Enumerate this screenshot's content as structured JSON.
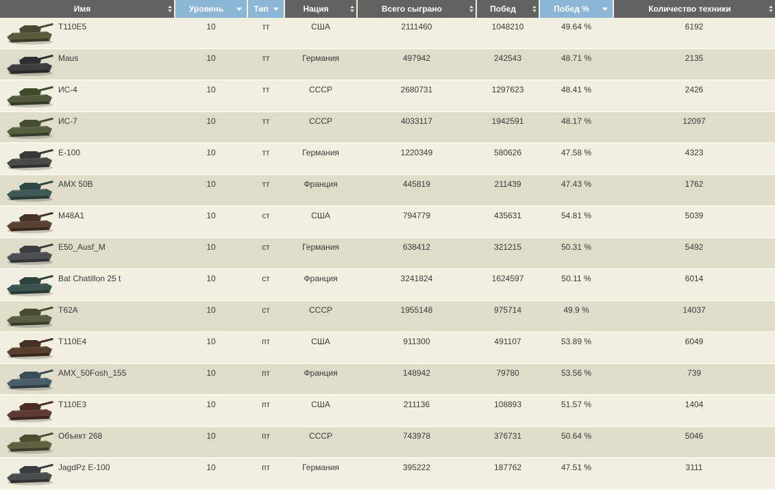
{
  "headers": [
    {
      "key": "name",
      "label": "Имя",
      "sorted": false,
      "icon": "sort-icon"
    },
    {
      "key": "level",
      "label": "Уровень",
      "sorted": true,
      "icon": "chevron-down-icon"
    },
    {
      "key": "type",
      "label": "Тип",
      "sorted": true,
      "icon": "chevron-down-icon"
    },
    {
      "key": "nation",
      "label": "Нация",
      "sorted": false,
      "icon": "sort-icon"
    },
    {
      "key": "played",
      "label": "Всего сыграно",
      "sorted": false,
      "icon": "sort-icon"
    },
    {
      "key": "wins",
      "label": "Побед",
      "sorted": false,
      "icon": "sort-icon"
    },
    {
      "key": "winrate",
      "label": "Побед %",
      "sorted": true,
      "icon": "chevron-down-icon"
    },
    {
      "key": "count",
      "label": "Количество техники",
      "sorted": false,
      "icon": "sort-icon"
    }
  ],
  "colors": {
    "header_bg": "#626262",
    "header_sorted_bg": "#8cb6d6",
    "row_odd": "#f1efe0",
    "row_even": "#dfdcca"
  },
  "rows": [
    {
      "name": "T110E5",
      "level": "10",
      "type": "тт",
      "nation": "США",
      "played": "2111460",
      "wins": "1048210",
      "winrate": "49.64 %",
      "count": "6192",
      "hull": "#5a5a3c",
      "turret": "#4a4a30"
    },
    {
      "name": "Maus",
      "level": "10",
      "type": "тт",
      "nation": "Германия",
      "played": "497942",
      "wins": "242543",
      "winrate": "48.71 %",
      "count": "2135",
      "hull": "#3e3e3e",
      "turret": "#2f2f2f"
    },
    {
      "name": "ИС-4",
      "level": "10",
      "type": "тт",
      "nation": "СССР",
      "played": "2680731",
      "wins": "1297623",
      "winrate": "48.41 %",
      "count": "2426",
      "hull": "#4f5a3a",
      "turret": "#3f4a2c"
    },
    {
      "name": "ИС-7",
      "level": "10",
      "type": "тт",
      "nation": "СССР",
      "played": "4033117",
      "wins": "1942591",
      "winrate": "48.17 %",
      "count": "12097",
      "hull": "#56603f",
      "turret": "#444e30"
    },
    {
      "name": "E-100",
      "level": "10",
      "type": "тт",
      "nation": "Германия",
      "played": "1220349",
      "wins": "580626",
      "winrate": "47.58 %",
      "count": "4323",
      "hull": "#4a4a4a",
      "turret": "#383838"
    },
    {
      "name": "AMX 50B",
      "level": "10",
      "type": "тт",
      "nation": "Франция",
      "played": "445819",
      "wins": "211439",
      "winrate": "47.43 %",
      "count": "1762",
      "hull": "#3f5a55",
      "turret": "#2f4843"
    },
    {
      "name": "M48A1",
      "level": "10",
      "type": "ст",
      "nation": "США",
      "played": "794779",
      "wins": "435631",
      "winrate": "54.81 %",
      "count": "5039",
      "hull": "#5a4030",
      "turret": "#483224"
    },
    {
      "name": "E50_Ausf_M",
      "level": "10",
      "type": "ст",
      "nation": "Германия",
      "played": "638412",
      "wins": "321215",
      "winrate": "50.31 %",
      "count": "5492",
      "hull": "#4c5050",
      "turret": "#3a3e3e"
    },
    {
      "name": "Bat Chatillon 25 t",
      "level": "10",
      "type": "ст",
      "nation": "Франция",
      "played": "3241824",
      "wins": "1624597",
      "winrate": "50.11 %",
      "count": "6014",
      "hull": "#3c534d",
      "turret": "#2e433d"
    },
    {
      "name": "T62A",
      "level": "10",
      "type": "ст",
      "nation": "СССР",
      "played": "1955148",
      "wins": "975714",
      "winrate": "49.9 %",
      "count": "14037",
      "hull": "#5a5e40",
      "turret": "#474b30"
    },
    {
      "name": "T110E4",
      "level": "10",
      "type": "пт",
      "nation": "США",
      "played": "911300",
      "wins": "491107",
      "winrate": "53.89 %",
      "count": "6049",
      "hull": "#5a3e30",
      "turret": "#483024"
    },
    {
      "name": "AMX_50Fosh_155",
      "level": "10",
      "type": "пт",
      "nation": "Франция",
      "played": "148942",
      "wins": "79780",
      "winrate": "53.56 %",
      "count": "739",
      "hull": "#4a6068",
      "turret": "#3a4e56"
    },
    {
      "name": "T110E3",
      "level": "10",
      "type": "пт",
      "nation": "США",
      "played": "211136",
      "wins": "108893",
      "winrate": "51.57 %",
      "count": "1404",
      "hull": "#5e3a30",
      "turret": "#4a2c24"
    },
    {
      "name": "Объект 268",
      "level": "10",
      "type": "пт",
      "nation": "СССР",
      "played": "743978",
      "wins": "376731",
      "winrate": "50.64 %",
      "count": "5046",
      "hull": "#5e6240",
      "turret": "#4b4f30"
    },
    {
      "name": "JagdPz E-100",
      "level": "10",
      "type": "пт",
      "nation": "Германия",
      "played": "395222",
      "wins": "187762",
      "winrate": "47.51 %",
      "count": "3111",
      "hull": "#4b4e4e",
      "turret": "#3a3d3d"
    }
  ]
}
